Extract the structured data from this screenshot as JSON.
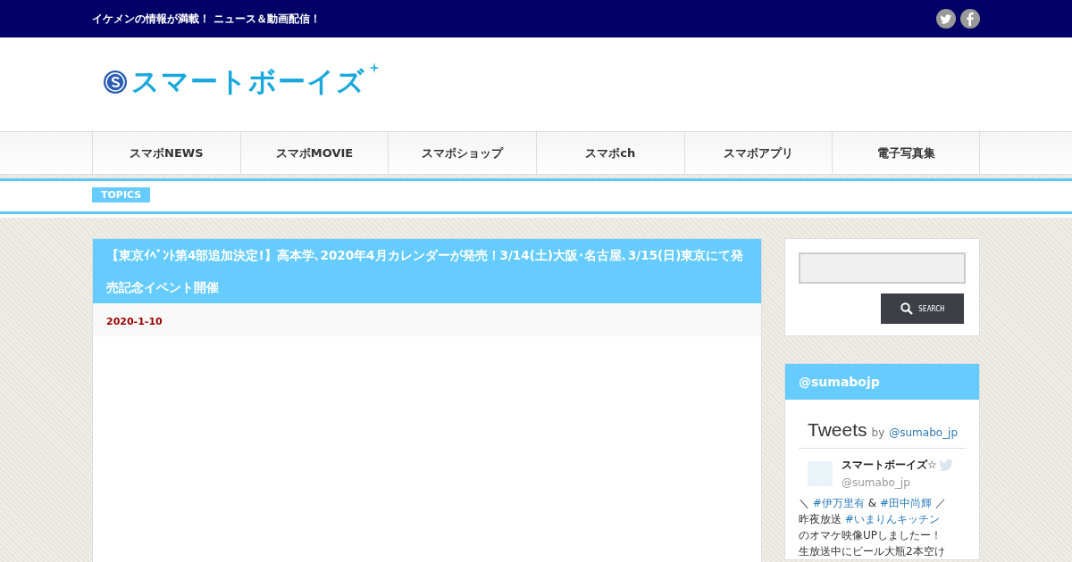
{
  "top_bar": {
    "tagline": "イケメンの情報が満載！ ニュース＆動画配信！",
    "social": [
      {
        "kind": "twitter"
      },
      {
        "kind": "facebook"
      }
    ]
  },
  "logo": {
    "text": "スマートボーイズ"
  },
  "nav": [
    {
      "label": "スマボNEWS"
    },
    {
      "label": "スマボMOVIE"
    },
    {
      "label": "スマボショップ"
    },
    {
      "label": "スマボch"
    },
    {
      "label": "スマボアプリ"
    },
    {
      "label": "電子写真集"
    }
  ],
  "topics": {
    "label": "TOPICS"
  },
  "article": {
    "title": "【東京ｲﾍﾞﾝﾄ第4部追加決定!】高本学､2020年4月カレンダーが発売！3/14(土)大阪･名古屋､3/15(日)東京にて発売記念イベント開催",
    "date": "2020-1-10"
  },
  "sidebar": {
    "search": {
      "button": "SEARCH"
    },
    "widget": {
      "title": "@sumabojp",
      "tweets_heading": "Tweets",
      "by": "by",
      "by_handle": "@sumabo_jp",
      "tweet": {
        "name": "スマートボーイズ☆",
        "handle": "@sumabo_jp",
        "lines": [
          [
            {
              "kind": "plain",
              "text": "＼ "
            },
            {
              "kind": "hashtag",
              "text": "#伊万里有"
            },
            {
              "kind": "plain",
              "text": " & "
            },
            {
              "kind": "hashtag",
              "text": "#田中尚輝"
            },
            {
              "kind": "plain",
              "text": " ／"
            }
          ],
          [
            {
              "kind": "plain",
              "text": "昨夜放送 "
            },
            {
              "kind": "hashtag",
              "text": "#いまりんキッチン"
            }
          ],
          [
            {
              "kind": "plain",
              "text": " のオマケ映像UPしましたー！"
            }
          ],
          [
            {
              "kind": "plain",
              "text": "生放送中にビール大瓶2本空け"
            }
          ]
        ]
      }
    }
  }
}
